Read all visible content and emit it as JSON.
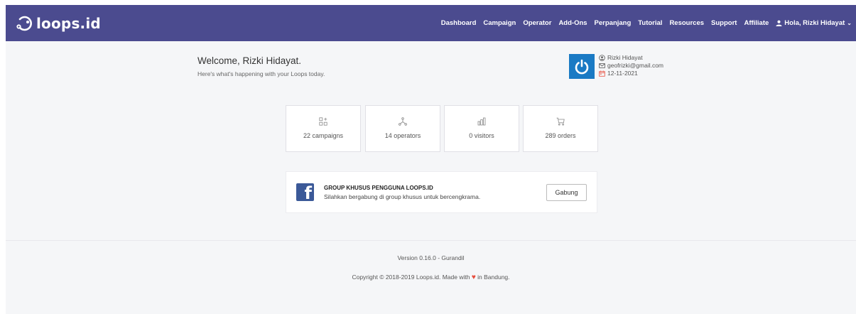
{
  "app": {
    "brand": "loops.id"
  },
  "nav": {
    "items": [
      "Dashboard",
      "Campaign",
      "Operator",
      "Add-Ons",
      "Perpanjang",
      "Tutorial",
      "Resources",
      "Support",
      "Affiliate"
    ],
    "user_label": "Hola, Rizki Hidayat",
    "caret": "⌄"
  },
  "welcome": {
    "title": "Welcome, Rizki Hidayat.",
    "subtitle": "Here's what's happening with your Loops today."
  },
  "profile": {
    "name": "Rizki Hidayat",
    "email": "geofrizki@gmail.com",
    "date": "12-11-2021"
  },
  "stats": [
    {
      "label": "22 campaigns",
      "icon": "campaigns-icon"
    },
    {
      "label": "14 operators",
      "icon": "operators-icon"
    },
    {
      "label": "0 visitors",
      "icon": "visitors-icon"
    },
    {
      "label": "289 orders",
      "icon": "orders-icon"
    }
  ],
  "facebook": {
    "title": "GROUP KHUSUS PENGGUNA LOOPS.ID",
    "subtitle": "Silahkan bergabung di group khusus untuk bercengkrama.",
    "button": "Gabung",
    "logo": "f"
  },
  "footer": {
    "version": "Version 0.16.0 - Gurandil",
    "copyright_prefix": "Copyright © 2018-2019 Loops.id. Made with",
    "heart": "♥",
    "copyright_suffix": "in Bandung."
  },
  "colors": {
    "navbar": "#4b4b8f",
    "avatar": "#1a7ac4",
    "facebook": "#3b5998",
    "heart": "#e74c3c"
  }
}
